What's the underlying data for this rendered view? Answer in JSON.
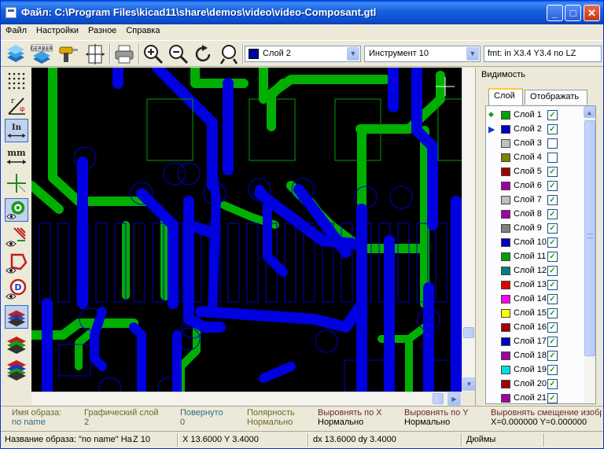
{
  "window": {
    "title": "Файл: C:\\Program Files\\kicad11\\share\\demos\\video\\video-Composant.gtl"
  },
  "menu": [
    "Файл",
    "Настройки",
    "Разное",
    "Справка"
  ],
  "toolbar": {
    "layer_combo": "Слой 2",
    "tool_combo": "Инструмент 10",
    "fmt_text": "fmt: in X3.4 Y3.4 no LZ",
    "layer_color": "#0000a8"
  },
  "right_panel": {
    "title": "Видимость",
    "tab_layer": "Слой",
    "tab_display": "Отображать",
    "layers": [
      {
        "name": "Слой 1",
        "color": "#00a000",
        "checked": true,
        "marker": "diamond"
      },
      {
        "name": "Слой 2",
        "color": "#0000c0",
        "checked": true,
        "marker": "arrow"
      },
      {
        "name": "Слой 3",
        "color": "#c0c0c0",
        "checked": false,
        "marker": ""
      },
      {
        "name": "Слой 4",
        "color": "#808000",
        "checked": false,
        "marker": ""
      },
      {
        "name": "Слой 5",
        "color": "#a00000",
        "checked": true,
        "marker": ""
      },
      {
        "name": "Слой 6",
        "color": "#a000a0",
        "checked": true,
        "marker": ""
      },
      {
        "name": "Слой 7",
        "color": "#c0c0c0",
        "checked": true,
        "marker": ""
      },
      {
        "name": "Слой 8",
        "color": "#a000a0",
        "checked": true,
        "marker": ""
      },
      {
        "name": "Слой 9",
        "color": "#808080",
        "checked": true,
        "marker": ""
      },
      {
        "name": "Слой 10",
        "color": "#0000c0",
        "checked": true,
        "marker": ""
      },
      {
        "name": "Слой 11",
        "color": "#00a000",
        "checked": true,
        "marker": ""
      },
      {
        "name": "Слой 12",
        "color": "#008080",
        "checked": true,
        "marker": ""
      },
      {
        "name": "Слой 13",
        "color": "#e00000",
        "checked": true,
        "marker": ""
      },
      {
        "name": "Слой 14",
        "color": "#ff00ff",
        "checked": true,
        "marker": ""
      },
      {
        "name": "Слой 15",
        "color": "#ffff00",
        "checked": true,
        "marker": ""
      },
      {
        "name": "Слой 16",
        "color": "#a00000",
        "checked": true,
        "marker": ""
      },
      {
        "name": "Слой 17",
        "color": "#0000c0",
        "checked": true,
        "marker": ""
      },
      {
        "name": "Слой 18",
        "color": "#a000a0",
        "checked": true,
        "marker": ""
      },
      {
        "name": "Слой 19",
        "color": "#00e0e0",
        "checked": true,
        "marker": ""
      },
      {
        "name": "Слой 20",
        "color": "#a00000",
        "checked": true,
        "marker": ""
      },
      {
        "name": "Слой 21",
        "color": "#a000a0",
        "checked": true,
        "marker": ""
      }
    ]
  },
  "info": {
    "image_name_label": "Имя образа:",
    "image_name_value": "no name",
    "graphic_layer_label": "Графический слой",
    "graphic_layer_value": "2",
    "rotated_label": "Повернуто",
    "rotated_value": "0",
    "polarity_label": "Полярность",
    "polarity_value": "Нормально",
    "align_x_label": "Выровнять по X",
    "align_x_value": "Нормально",
    "align_y_label": "Выровнять по Y",
    "align_y_value": "Нормально",
    "offset_label": "Выровнять смещение изобр",
    "offset_value": "X=0.000000 Y=0.000000"
  },
  "status": {
    "image_name": "Название образа: \"no name\"  Ha",
    "zoom": "Z 10",
    "coords": "X 13.6000  Y 3.4000",
    "delta": "dx 13.6000  dy 3.4000",
    "units": "Дюймы"
  }
}
